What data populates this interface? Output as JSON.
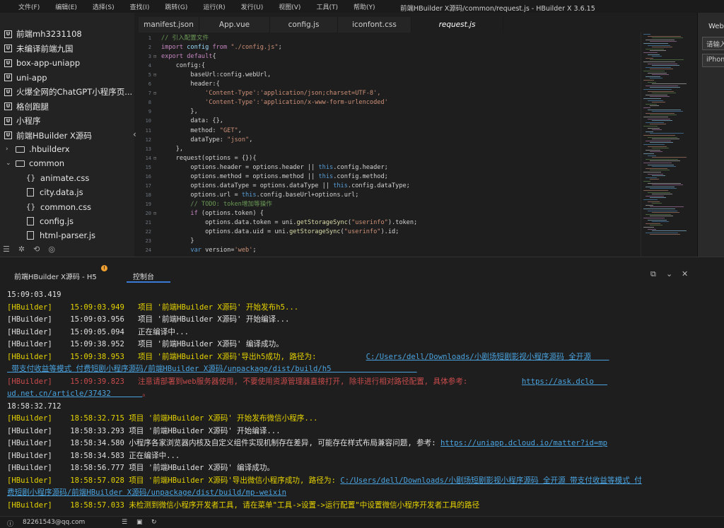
{
  "menubar": {
    "items": [
      "文件(F)",
      "编辑(E)",
      "选择(S)",
      "查找(I)",
      "跳转(G)",
      "运行(R)",
      "发行(U)",
      "视图(V)",
      "工具(T)",
      "帮助(Y)"
    ],
    "title": "前端HBuilder X源码/common/request.js - HBuilder X 3.6.15"
  },
  "sidebar": {
    "projects": [
      "前端mh3231108",
      "未编译前端九国",
      "box-app-uniapp",
      "uni-app",
      "火爆全网的ChatGPT小程序页...",
      "格创跑腿",
      "小程序",
      "前端HBuilder X源码"
    ],
    "tree": [
      {
        "label": ".hbuilderx",
        "icon": "folder",
        "arrow": "›"
      },
      {
        "label": "common",
        "icon": "folder-open",
        "arrow": "⌄"
      },
      {
        "label": "animate.css",
        "icon": "{}"
      },
      {
        "label": "city.data.js",
        "icon": "file"
      },
      {
        "label": "common.css",
        "icon": "{}"
      },
      {
        "label": "config.js",
        "icon": "file"
      },
      {
        "label": "html-parser.js",
        "icon": "file"
      }
    ]
  },
  "editor": {
    "tabs": [
      "manifest.json",
      "App.vue",
      "config.js",
      "iconfont.css",
      "request.js"
    ],
    "active_tab": "request.js",
    "line_numbers": [
      "1",
      "2",
      "3",
      "4",
      "5",
      "6",
      "7",
      "8",
      "9",
      "10",
      "11",
      "12",
      "13",
      "14",
      "15",
      "16",
      "17",
      "18",
      "19",
      "20",
      "21",
      "22",
      "23",
      "24"
    ],
    "fold_markers": [
      "",
      "",
      "⊟",
      "",
      "⊟",
      "",
      "⊟",
      "",
      "",
      "",
      "",
      "",
      "",
      "⊟",
      "",
      "",
      "",
      "",
      "",
      "⊟",
      "",
      "",
      "",
      ""
    ],
    "lines": [
      [
        {
          "c": "c",
          "t": "// 引入配置文件"
        }
      ],
      [
        {
          "c": "k",
          "t": "import "
        },
        {
          "c": "p",
          "t": "config "
        },
        {
          "c": "k",
          "t": "from "
        },
        {
          "c": "s",
          "t": "\"./config.js\""
        },
        {
          "c": "t",
          "t": ";"
        }
      ],
      [
        {
          "c": "k",
          "t": "export default"
        },
        {
          "c": "t",
          "t": "{"
        }
      ],
      [
        {
          "c": "t",
          "t": "    config:{"
        }
      ],
      [
        {
          "c": "t",
          "t": "        baseUrl:config.webUrl,"
        }
      ],
      [
        {
          "c": "t",
          "t": "        header:{"
        }
      ],
      [
        {
          "c": "s",
          "t": "            'Content-Type':'application/json;charset=UTF-8',"
        }
      ],
      [
        {
          "c": "s",
          "t": "            'Content-Type':'application/x-www-form-urlencoded'"
        }
      ],
      [
        {
          "c": "t",
          "t": "        },"
        }
      ],
      [
        {
          "c": "t",
          "t": "        data: {},"
        }
      ],
      [
        {
          "c": "t",
          "t": "        method: "
        },
        {
          "c": "s",
          "t": "\"GET\""
        },
        {
          "c": "t",
          "t": ","
        }
      ],
      [
        {
          "c": "t",
          "t": "        dataType: "
        },
        {
          "c": "s",
          "t": "\"json\""
        },
        {
          "c": "t",
          "t": ","
        }
      ],
      [
        {
          "c": "t",
          "t": "    },"
        }
      ],
      [
        {
          "c": "t",
          "t": "    request(options = {}){"
        }
      ],
      [
        {
          "c": "t",
          "t": "        options.header = options.header || "
        },
        {
          "c": "kw",
          "t": "this"
        },
        {
          "c": "t",
          "t": ".config.header;"
        }
      ],
      [
        {
          "c": "t",
          "t": "        options.method = options.method || "
        },
        {
          "c": "kw",
          "t": "this"
        },
        {
          "c": "t",
          "t": ".config.method;"
        }
      ],
      [
        {
          "c": "t",
          "t": "        options.dataType = options.dataType || "
        },
        {
          "c": "kw",
          "t": "this"
        },
        {
          "c": "t",
          "t": ".config.dataType;"
        }
      ],
      [
        {
          "c": "t",
          "t": "        options.url = "
        },
        {
          "c": "kw",
          "t": "this"
        },
        {
          "c": "t",
          "t": ".config.baseUrl+options.url;"
        }
      ],
      [
        {
          "c": "c",
          "t": "        // TODO: token增加等操作"
        }
      ],
      [
        {
          "c": "k",
          "t": "        if "
        },
        {
          "c": "t",
          "t": "(options.token) {"
        }
      ],
      [
        {
          "c": "t",
          "t": "            options.data.token = uni."
        },
        {
          "c": "f",
          "t": "getStorageSync"
        },
        {
          "c": "t",
          "t": "("
        },
        {
          "c": "s",
          "t": "\"userinfo\""
        },
        {
          "c": "t",
          "t": ").token;"
        }
      ],
      [
        {
          "c": "t",
          "t": "            options.data.uid = uni."
        },
        {
          "c": "f",
          "t": "getStorageSync"
        },
        {
          "c": "t",
          "t": "("
        },
        {
          "c": "s",
          "t": "\"userinfo\""
        },
        {
          "c": "t",
          "t": ").id;"
        }
      ],
      [
        {
          "c": "t",
          "t": "        }"
        }
      ],
      [
        {
          "c": "kw",
          "t": "        var "
        },
        {
          "c": "t",
          "t": "version="
        },
        {
          "c": "s",
          "t": "'web'"
        },
        {
          "c": "t",
          "t": ";"
        }
      ]
    ]
  },
  "right_panel": {
    "title": "Web浏览器",
    "input1": "请输入",
    "input2": "iPhone"
  },
  "console": {
    "tabs": [
      "前端HBuilder X源码 - H5",
      "控制台"
    ],
    "active_tab": "控制台",
    "warn_badge": "!",
    "rows": [
      {
        "parts": [
          {
            "c": "w",
            "t": "15:09:03.419"
          }
        ]
      },
      {
        "parts": [
          {
            "c": "y",
            "t": "[HBuilder]    15:09:03.949   项目 '前端HBuilder X源码' 开始发布h5..."
          }
        ]
      },
      {
        "parts": [
          {
            "c": "w",
            "t": "[HBuilder]    15:09:03.956   项目 '前端HBuilder X源码' 开始编译..."
          }
        ]
      },
      {
        "parts": [
          {
            "c": "w",
            "t": "[HBuilder]    15:09:05.094   正在编译中..."
          }
        ]
      },
      {
        "parts": [
          {
            "c": "w",
            "t": "[HBuilder]    15:09:38.952   项目 '前端HBuilder X源码' 编译成功。"
          }
        ]
      },
      {
        "parts": [
          {
            "c": "y",
            "t": "[HBuilder]    15:09:38.953   项目 '前端HBuilder X源码'导出h5成功, 路径为:           "
          },
          {
            "c": "lk",
            "t": "C:/Users/dell/Downloads/小剧场短剧影视小程序源码 全开源    "
          }
        ]
      },
      {
        "parts": [
          {
            "c": "lk",
            "t": " 带支付收益等模式 付费短剧小程序源码/前端HBuilder X源码/unpackage/dist/build/h5                   "
          }
        ]
      },
      {
        "parts": [
          {
            "c": "rd",
            "t": "[HBuilder]    15:09:39.823   注意请部署到web服务器使用, 不要使用资源管理器直接打开, 除非进行相对路径配置, 具体参考:            "
          },
          {
            "c": "lk",
            "t": "https://ask.dclo   "
          }
        ]
      },
      {
        "parts": [
          {
            "c": "lk",
            "t": "ud.net.cn/article/37432       "
          },
          {
            "c": "rd",
            "t": "。"
          }
        ]
      },
      {
        "parts": [
          {
            "c": "w",
            "t": "18:58:32.712"
          }
        ]
      },
      {
        "parts": [
          {
            "c": "y",
            "t": "[HBuilder]    18:58:32.715 项目 '前端HBuilder X源码' 开始发布微信小程序..."
          }
        ]
      },
      {
        "parts": [
          {
            "c": "w",
            "t": "[HBuilder]    18:58:33.293 项目 '前端HBuilder X源码' 开始编译..."
          }
        ]
      },
      {
        "parts": [
          {
            "c": "w",
            "t": "[HBuilder]    18:58:34.580 小程序各家浏览器内核及自定义组件实现机制存在差异, 可能存在样式布局兼容问题, 参考: "
          },
          {
            "c": "lk",
            "t": "https://uniapp.dcloud.io/matter?id=mp"
          }
        ]
      },
      {
        "parts": [
          {
            "c": "w",
            "t": "[HBuilder]    18:58:34.583 正在编译中..."
          }
        ]
      },
      {
        "parts": [
          {
            "c": "w",
            "t": "[HBuilder]    18:58:56.777 项目 '前端HBuilder X源码' 编译成功。"
          }
        ]
      },
      {
        "parts": [
          {
            "c": "y",
            "t": "[HBuilder]    18:58:57.028 项目 '前端HBuilder X源码'导出微信小程序成功, 路径为: "
          },
          {
            "c": "lk",
            "t": "C:/Users/dell/Downloads/小剧场短剧影视小程序源码 全开源 带支付收益等模式 付"
          }
        ]
      },
      {
        "parts": [
          {
            "c": "lk",
            "t": "费短剧小程序源码/前端HBuilder X源码/unpackage/dist/build/mp-weixin"
          }
        ]
      },
      {
        "parts": [
          {
            "c": "y",
            "t": "[HBuilder]    18:58:57.033 未检测到微信小程序开发者工具, 请在菜单\"工具->设置->运行配置\"中设置微信小程序开发者工具的路径"
          }
        ]
      }
    ]
  },
  "status": {
    "user": "82261543@qq.com"
  },
  "colors": {
    "accent": "#3a7ad6",
    "yellow_log": "#e6d300",
    "red_log": "#c94b4b",
    "link": "#4aa3df"
  }
}
